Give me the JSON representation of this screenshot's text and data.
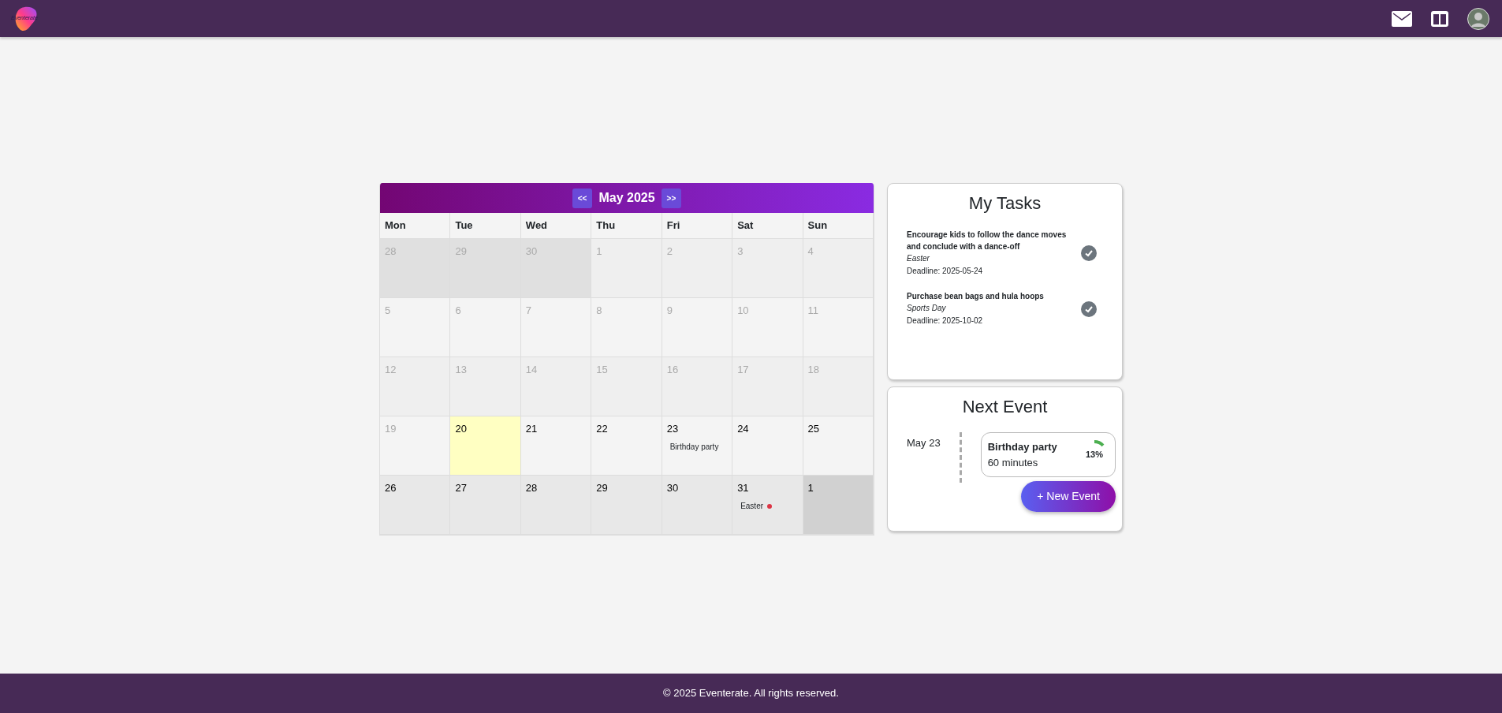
{
  "header": {
    "logo_text": "Eventerate"
  },
  "calendar": {
    "prev": "<<",
    "month": "May 2025",
    "next": ">>",
    "weekdays": [
      "Mon",
      "Tue",
      "Wed",
      "Thu",
      "Fri",
      "Sat",
      "Sun"
    ],
    "weeks": [
      [
        {
          "day": "28",
          "past": true,
          "outside": true,
          "today": false
        },
        {
          "day": "29",
          "past": true,
          "outside": true,
          "today": false
        },
        {
          "day": "30",
          "past": true,
          "outside": true,
          "today": false
        },
        {
          "day": "1",
          "past": true,
          "outside": false,
          "today": false
        },
        {
          "day": "2",
          "past": true,
          "outside": false,
          "today": false
        },
        {
          "day": "3",
          "past": true,
          "outside": false,
          "today": false
        },
        {
          "day": "4",
          "past": true,
          "outside": false,
          "today": false
        }
      ],
      [
        {
          "day": "5",
          "past": true,
          "outside": false,
          "today": false
        },
        {
          "day": "6",
          "past": true,
          "outside": false,
          "today": false
        },
        {
          "day": "7",
          "past": true,
          "outside": false,
          "today": false
        },
        {
          "day": "8",
          "past": true,
          "outside": false,
          "today": false
        },
        {
          "day": "9",
          "past": true,
          "outside": false,
          "today": false
        },
        {
          "day": "10",
          "past": true,
          "outside": false,
          "today": false
        },
        {
          "day": "11",
          "past": true,
          "outside": false,
          "today": false
        }
      ],
      [
        {
          "day": "12",
          "past": true,
          "outside": false,
          "today": false
        },
        {
          "day": "13",
          "past": true,
          "outside": false,
          "today": false
        },
        {
          "day": "14",
          "past": true,
          "outside": false,
          "today": false
        },
        {
          "day": "15",
          "past": true,
          "outside": false,
          "today": false
        },
        {
          "day": "16",
          "past": true,
          "outside": false,
          "today": false
        },
        {
          "day": "17",
          "past": true,
          "outside": false,
          "today": false
        },
        {
          "day": "18",
          "past": true,
          "outside": false,
          "today": false
        }
      ],
      [
        {
          "day": "19",
          "past": true,
          "outside": false,
          "today": false
        },
        {
          "day": "20",
          "past": false,
          "outside": false,
          "today": true
        },
        {
          "day": "21",
          "past": false,
          "outside": false,
          "today": false
        },
        {
          "day": "22",
          "past": false,
          "outside": false,
          "today": false
        },
        {
          "day": "23",
          "past": false,
          "outside": false,
          "today": false,
          "events": [
            {
              "title": "Birthday party"
            }
          ]
        },
        {
          "day": "24",
          "past": false,
          "outside": false,
          "today": false
        },
        {
          "day": "25",
          "past": false,
          "outside": false,
          "today": false
        }
      ],
      [
        {
          "day": "26",
          "past": false,
          "outside": false,
          "today": false
        },
        {
          "day": "27",
          "past": false,
          "outside": false,
          "today": false
        },
        {
          "day": "28",
          "past": false,
          "outside": false,
          "today": false
        },
        {
          "day": "29",
          "past": false,
          "outside": false,
          "today": false
        },
        {
          "day": "30",
          "past": false,
          "outside": false,
          "today": false
        },
        {
          "day": "31",
          "past": false,
          "outside": false,
          "today": false,
          "events": [
            {
              "title": "Easter",
              "color": "#dc3545"
            }
          ]
        },
        {
          "day": "1",
          "past": false,
          "outside": true,
          "today": false
        }
      ]
    ]
  },
  "tasks": {
    "title": "My Tasks",
    "items": [
      {
        "title": "Encourage kids to follow the dance moves and conclude with a dance-off",
        "event": "Easter",
        "deadline": "Deadline: 2025-05-24"
      },
      {
        "title": "Purchase bean bags and hula hoops",
        "event": "Sports Day",
        "deadline": "Deadline: 2025-10-02"
      }
    ]
  },
  "next_event": {
    "title": "Next Event",
    "date": "May 23",
    "name": "Birthday party",
    "duration": "60 minutes",
    "level": 0.13,
    "percent": "13%",
    "button": "+ New Event"
  },
  "footer": "© 2025 Eventerate. All rights reserved."
}
